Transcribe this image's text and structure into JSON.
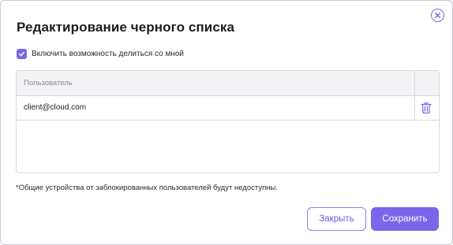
{
  "dialog": {
    "title": "Редактирование черного списка",
    "close_icon": "close-circle-icon"
  },
  "share_option": {
    "label": "Включить возможность делиться со мной",
    "checked": true
  },
  "table": {
    "columns": [
      "Пользователь"
    ],
    "rows": [
      {
        "user": "client@cloud.com",
        "action_icon": "trash-icon"
      }
    ]
  },
  "footnote": "*Общие устройства от заблокированных пользователей будут недоступны.",
  "buttons": {
    "close_label": "Закрыть",
    "save_label": "Сохранить"
  },
  "colors": {
    "accent": "#7a66e8",
    "border": "#d9d9de",
    "header_bg": "#f3f3f5"
  }
}
